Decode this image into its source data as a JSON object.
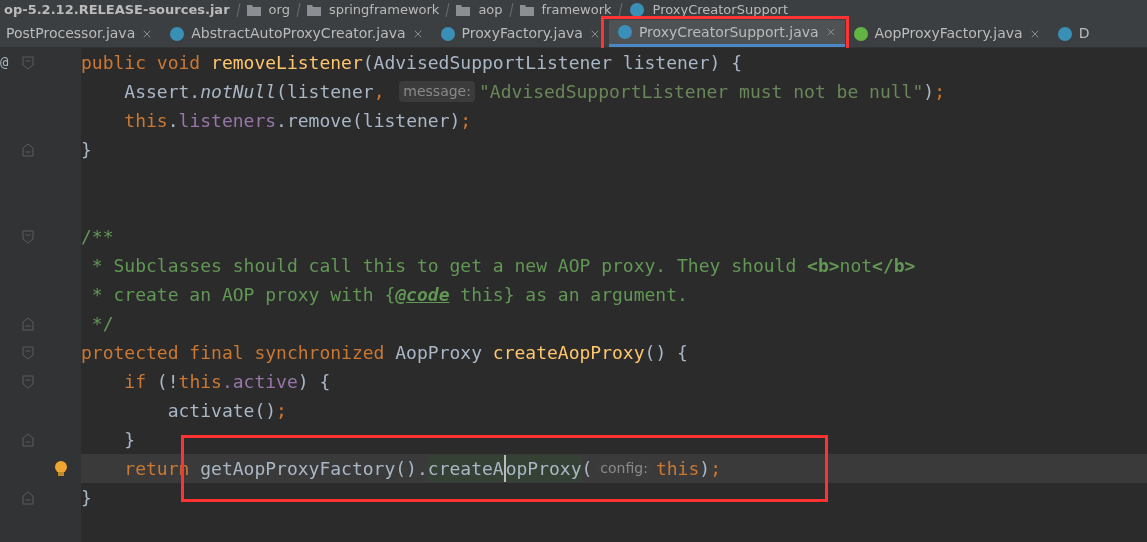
{
  "breadcrumb": [
    {
      "label": "op-5.2.12.RELEASE-sources.jar"
    },
    {
      "kind": "folder",
      "label": "org"
    },
    {
      "kind": "folder",
      "label": "springframework"
    },
    {
      "kind": "folder",
      "label": "aop"
    },
    {
      "kind": "folder",
      "label": "framework"
    },
    {
      "kind": "class",
      "label": "ProxyCreatorSupport"
    }
  ],
  "tabs": [
    {
      "kind": "none",
      "label": "PostProcessor.java",
      "selected": false,
      "annotated": false,
      "closable": true
    },
    {
      "kind": "class",
      "label": "AbstractAutoProxyCreator.java",
      "selected": false,
      "annotated": false,
      "closable": true
    },
    {
      "kind": "class",
      "label": "ProxyFactory.java",
      "selected": false,
      "annotated": false,
      "closable": true
    },
    {
      "kind": "class",
      "label": "ProxyCreatorSupport.java",
      "selected": true,
      "annotated": true,
      "closable": true
    },
    {
      "kind": "interface",
      "label": "AopProxyFactory.java",
      "selected": false,
      "annotated": false,
      "closable": true
    },
    {
      "kind": "class",
      "label": "D",
      "selected": false,
      "annotated": false,
      "closable": false
    }
  ],
  "lines": [
    {
      "mark": "@",
      "fold_start": true,
      "fold_end": false,
      "tokens": [
        {
          "kind": "kw",
          "t": "public void "
        },
        {
          "kind": "decl",
          "t": "removeListener"
        },
        {
          "kind": "plain",
          "t": "(AdvisedSupportListener listener) {"
        }
      ]
    },
    {
      "fold_start": false,
      "fold_end": false,
      "tokens": [
        {
          "kind": "plain",
          "t": "    Assert."
        },
        {
          "kind": "italic",
          "t": "notNull"
        },
        {
          "kind": "plain",
          "t": "(listener"
        },
        {
          "kind": "kw",
          "t": ", "
        },
        {
          "kind": "hint",
          "t": "message:"
        },
        {
          "kind": "str",
          "t": "\"AdvisedSupportListener must not be null\""
        },
        {
          "kind": "plain",
          "t": ")"
        },
        {
          "kind": "kw",
          "t": ";"
        }
      ]
    },
    {
      "fold_start": false,
      "fold_end": false,
      "tokens": [
        {
          "kind": "kw",
          "t": "    this"
        },
        {
          "kind": "plain",
          "t": "."
        },
        {
          "kind": "field",
          "t": "listeners"
        },
        {
          "kind": "plain",
          "t": ".remove(listener)"
        },
        {
          "kind": "kw",
          "t": ";"
        }
      ]
    },
    {
      "fold_start": false,
      "fold_end": true,
      "tokens": [
        {
          "kind": "plain",
          "t": "}"
        }
      ]
    },
    {
      "fold_start": false,
      "fold_end": false
    },
    {
      "fold_start": false,
      "fold_end": false
    },
    {
      "fold_start": true,
      "fold_end": false,
      "tokens": [
        {
          "kind": "doc",
          "t": "/**"
        }
      ]
    },
    {
      "fold_start": false,
      "fold_end": false,
      "tokens": [
        {
          "kind": "doc",
          "t": " * Subclasses should call this to get a new AOP proxy. They should "
        },
        {
          "kind": "doctag",
          "t": "<b>"
        },
        {
          "kind": "doc",
          "t": "not"
        },
        {
          "kind": "doctag",
          "t": "</b>"
        }
      ]
    },
    {
      "fold_start": false,
      "fold_end": false,
      "tokens": [
        {
          "kind": "doc",
          "t": " * create an AOP proxy with {"
        },
        {
          "kind": "docref",
          "t": "@code"
        },
        {
          "kind": "doc",
          "t": " this} as an argument."
        }
      ]
    },
    {
      "fold_start": false,
      "fold_end": true,
      "tokens": [
        {
          "kind": "doc",
          "t": " */"
        }
      ]
    },
    {
      "fold_start": true,
      "fold_end": false,
      "tokens": [
        {
          "kind": "kw",
          "t": "protected final synchronized "
        },
        {
          "kind": "plain",
          "t": "AopProxy "
        },
        {
          "kind": "decl",
          "t": "createAopProxy"
        },
        {
          "kind": "plain",
          "t": "() {"
        }
      ]
    },
    {
      "fold_start": true,
      "fold_end": false,
      "tokens": [
        {
          "kind": "kw",
          "t": "    if "
        },
        {
          "kind": "plain",
          "t": "(!"
        },
        {
          "kind": "kw",
          "t": "this"
        },
        {
          "kind": "field",
          "t": ".active"
        },
        {
          "kind": "plain",
          "t": ") {"
        }
      ]
    },
    {
      "fold_start": false,
      "fold_end": false,
      "tokens": [
        {
          "kind": "plain",
          "t": "        activate()"
        },
        {
          "kind": "kw",
          "t": ";"
        }
      ]
    },
    {
      "fold_start": false,
      "fold_end": true,
      "tokens": [
        {
          "kind": "plain",
          "t": "    }"
        }
      ]
    },
    {
      "fold_start": false,
      "fold_end": false,
      "bulb": true,
      "current": true,
      "annotated": true,
      "tokens": [
        {
          "kind": "kw",
          "t": "    return "
        },
        {
          "kind": "plain",
          "t": "getAopProxyFactory()."
        },
        {
          "kind": "usage",
          "t": "createA"
        },
        {
          "kind": "usage",
          "t": "opProxy",
          "caret_before": true
        },
        {
          "kind": "plain",
          "t": "("
        },
        {
          "kind": "hint",
          "t": "config:"
        },
        {
          "kind": "kw",
          "t": "this"
        },
        {
          "kind": "plain",
          "t": ")"
        },
        {
          "kind": "kw",
          "t": ";"
        }
      ]
    },
    {
      "fold_start": false,
      "fold_end": true,
      "tokens": [
        {
          "kind": "plain",
          "t": "}"
        }
      ]
    }
  ]
}
